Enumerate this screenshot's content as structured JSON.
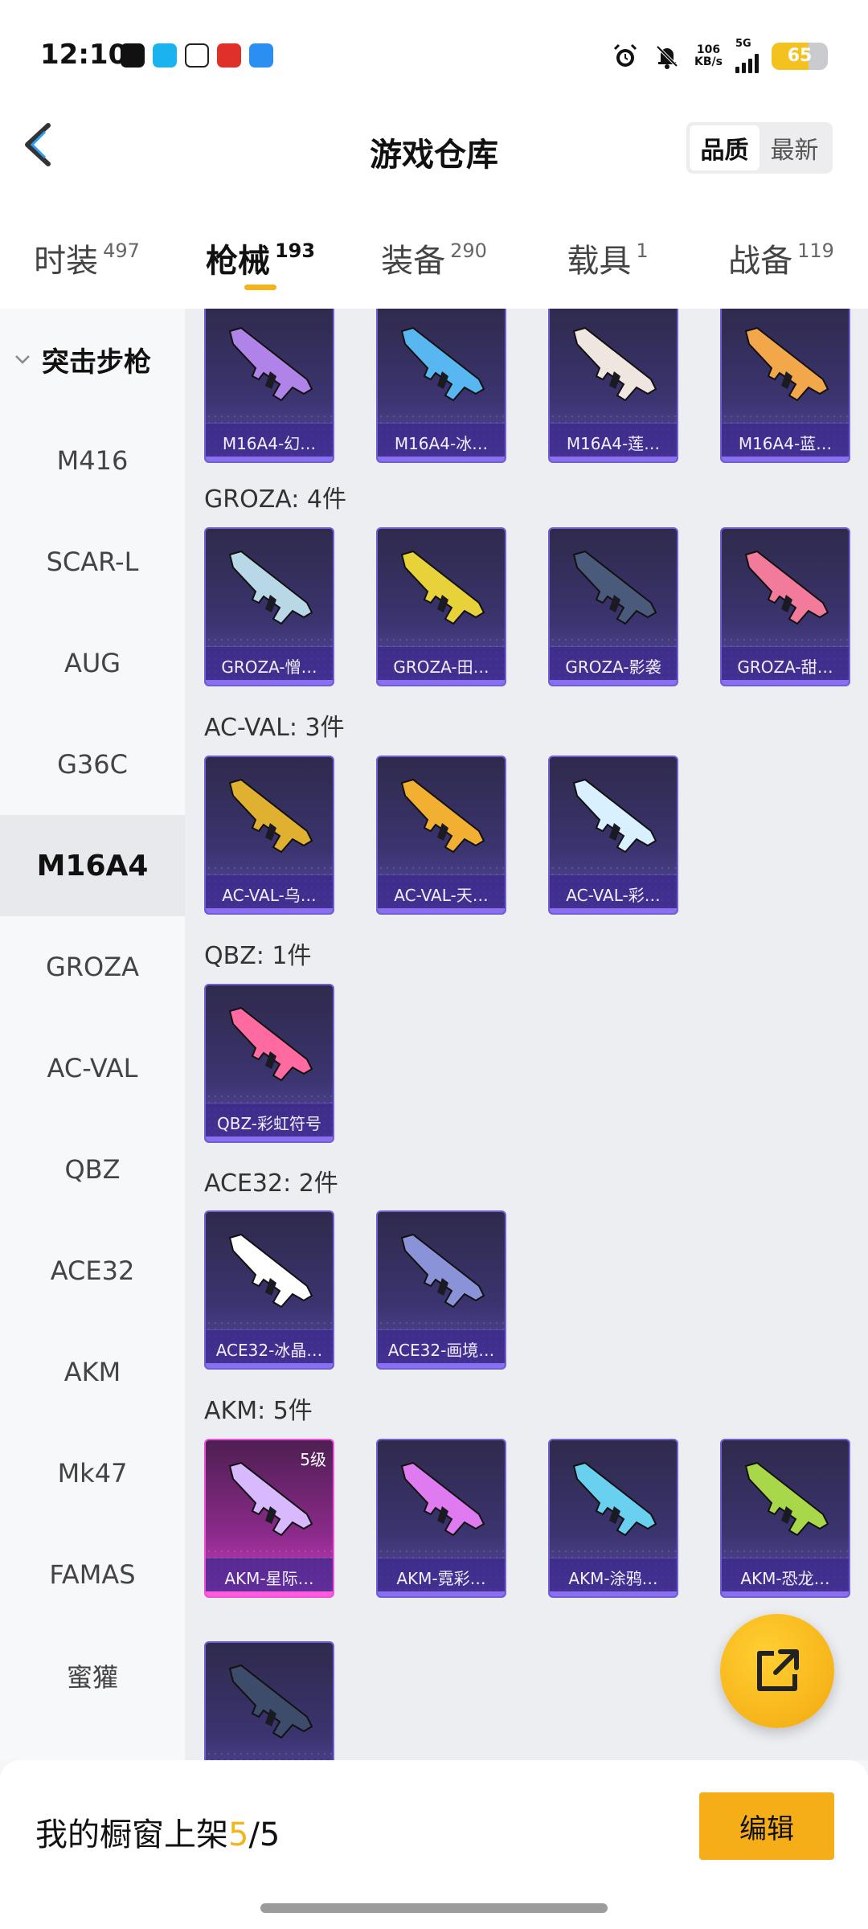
{
  "status": {
    "time": "12:10",
    "net_speed_top": "106",
    "net_speed_bottom": "KB/s",
    "network": "5G",
    "battery": "65"
  },
  "header": {
    "title": "游戏仓库",
    "sort_options": [
      "品质",
      "最新"
    ],
    "sort_selected": "品质"
  },
  "tabs": [
    {
      "label": "时装",
      "count": "497"
    },
    {
      "label": "枪械",
      "count": "193"
    },
    {
      "label": "装备",
      "count": "290"
    },
    {
      "label": "载具",
      "count": "1"
    },
    {
      "label": "战备",
      "count": "119"
    }
  ],
  "active_tab": "枪械",
  "sidebar": {
    "group": "突击步枪",
    "items": [
      "M416",
      "SCAR-L",
      "AUG",
      "G36C",
      "M16A4",
      "GROZA",
      "AC-VAL",
      "QBZ",
      "ACE32",
      "AKM",
      "Mk47",
      "FAMAS",
      "蜜獾"
    ],
    "active": "M16A4"
  },
  "sections": {
    "m16": {
      "items": [
        {
          "name": "M16A4-幻…",
          "color": "#b083e8"
        },
        {
          "name": "M16A4-冰…",
          "color": "#58b6f0"
        },
        {
          "name": "M16A4-莲…",
          "color": "#f0e6e0"
        },
        {
          "name": "M16A4-蓝…",
          "color": "#f2a84a"
        }
      ]
    },
    "groza": {
      "title": "GROZA: 4件",
      "items": [
        {
          "name": "GROZA-憎…",
          "color": "#b8d8e8"
        },
        {
          "name": "GROZA-田…",
          "color": "#e8d23a"
        },
        {
          "name": "GROZA-影袭",
          "color": "#4a5a7a"
        },
        {
          "name": "GROZA-甜…",
          "color": "#f27a9a"
        }
      ]
    },
    "acval": {
      "title": "AC-VAL: 3件",
      "items": [
        {
          "name": "AC-VAL-乌…",
          "color": "#e0b030"
        },
        {
          "name": "AC-VAL-天…",
          "color": "#f2b033"
        },
        {
          "name": "AC-VAL-彩…",
          "color": "#d8f0ff"
        }
      ]
    },
    "qbz": {
      "title": "QBZ: 1件",
      "items": [
        {
          "name": "QBZ-彩虹符号",
          "color": "#ff6aa0"
        }
      ]
    },
    "ace32": {
      "title": "ACE32: 2件",
      "items": [
        {
          "name": "ACE32-冰晶…",
          "color": "#ffffff"
        },
        {
          "name": "ACE32-画境…",
          "color": "#8a92d8"
        }
      ]
    },
    "akm": {
      "title": "AKM: 5件",
      "items": [
        {
          "name": "AKM-星际…",
          "color": "#d8b8ff",
          "level": "5级"
        },
        {
          "name": "AKM-霓彩…",
          "color": "#e07af0"
        },
        {
          "name": "AKM-涂鸦…",
          "color": "#6ad0f0"
        },
        {
          "name": "AKM-恐龙…",
          "color": "#a8d84a"
        },
        {
          "name": "",
          "color": "#3c4c6a"
        }
      ]
    }
  },
  "bottom": {
    "shelf_label": "我的橱窗上架",
    "shelf_current": "5",
    "shelf_total": "/5",
    "edit_label": "编辑"
  }
}
